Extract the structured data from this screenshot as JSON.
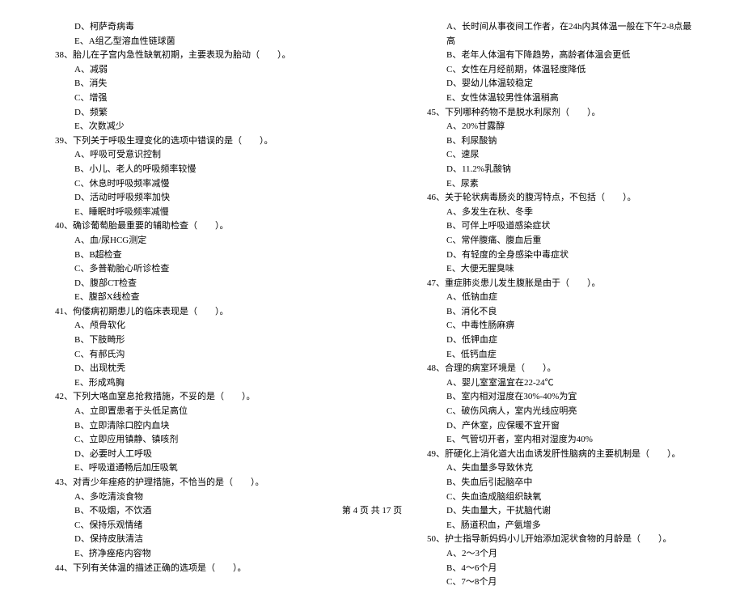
{
  "left": [
    {
      "t": "o",
      "text": "D、柯萨奇病毒"
    },
    {
      "t": "o",
      "text": "E、A组乙型溶血性链球菌"
    },
    {
      "t": "q",
      "text": "38、胎儿在子宫内急性缺氧初期，主要表现为胎动（　　）。"
    },
    {
      "t": "o",
      "text": "A、减弱"
    },
    {
      "t": "o",
      "text": "B、消失"
    },
    {
      "t": "o",
      "text": "C、增强"
    },
    {
      "t": "o",
      "text": "D、频繁"
    },
    {
      "t": "o",
      "text": "E、次数减少"
    },
    {
      "t": "q",
      "text": "39、下列关于呼吸生理变化的选项中错误的是（　　）。"
    },
    {
      "t": "o",
      "text": "A、呼吸可受意识控制"
    },
    {
      "t": "o",
      "text": "B、小儿、老人的呼吸频率较慢"
    },
    {
      "t": "o",
      "text": "C、休息时呼吸频率减慢"
    },
    {
      "t": "o",
      "text": "D、活动时呼吸频率加快"
    },
    {
      "t": "o",
      "text": "E、睡眠时呼吸频率减慢"
    },
    {
      "t": "q",
      "text": "40、确诊葡萄胎最重要的辅助检查（　　）。"
    },
    {
      "t": "o",
      "text": "A、血/尿HCG测定"
    },
    {
      "t": "o",
      "text": "B、B超检查"
    },
    {
      "t": "o",
      "text": "C、多普勒胎心听诊检查"
    },
    {
      "t": "o",
      "text": "D、腹部CT检查"
    },
    {
      "t": "o",
      "text": "E、腹部X线检查"
    },
    {
      "t": "q",
      "text": "41、佝偻病初期患儿的临床表现是（　　）。"
    },
    {
      "t": "o",
      "text": "A、颅骨软化"
    },
    {
      "t": "o",
      "text": "B、下肢畸形"
    },
    {
      "t": "o",
      "text": "C、有郝氏沟"
    },
    {
      "t": "o",
      "text": "D、出现枕秃"
    },
    {
      "t": "o",
      "text": "E、形成鸡胸"
    },
    {
      "t": "q",
      "text": "42、下列大咯血窒息抢救措施，不妥的是（　　）。"
    },
    {
      "t": "o",
      "text": "A、立即置患者于头低足高位"
    },
    {
      "t": "o",
      "text": "B、立即清除口腔内血块"
    },
    {
      "t": "o",
      "text": "C、立即应用镇静、镇咳剂"
    },
    {
      "t": "o",
      "text": "D、必要时人工呼吸"
    },
    {
      "t": "o",
      "text": "E、呼吸道通畅后加压吸氧"
    },
    {
      "t": "q",
      "text": "43、对青少年痤疮的护理措施，不恰当的是（　　）。"
    },
    {
      "t": "o",
      "text": "A、多吃清淡食物"
    },
    {
      "t": "o",
      "text": "B、不吸烟，不饮酒"
    },
    {
      "t": "o",
      "text": "C、保持乐观情绪"
    },
    {
      "t": "o",
      "text": "D、保持皮肤清洁"
    },
    {
      "t": "o",
      "text": "E、挤净痤疮内容物"
    },
    {
      "t": "q",
      "text": "44、下列有关体温的描述正确的选项是（　　）。"
    }
  ],
  "right": [
    {
      "t": "o",
      "text": "A、长时间从事夜间工作者，在24h内其体温一般在下午2-8点最高"
    },
    {
      "t": "o",
      "text": "B、老年人体温有下降趋势，高龄者体温会更低"
    },
    {
      "t": "o",
      "text": "C、女性在月经前期，体温轻度降低"
    },
    {
      "t": "o",
      "text": "D、婴幼儿体温较稳定"
    },
    {
      "t": "o",
      "text": "E、女性体温较男性体温稍高"
    },
    {
      "t": "q",
      "text": "45、下列哪种药物不是脱水利尿剂（　　）。"
    },
    {
      "t": "o",
      "text": "A、20%甘露醇"
    },
    {
      "t": "o",
      "text": "B、利尿酸钠"
    },
    {
      "t": "o",
      "text": "C、速尿"
    },
    {
      "t": "o",
      "text": "D、11.2%乳酸钠"
    },
    {
      "t": "o",
      "text": "E、尿素"
    },
    {
      "t": "q",
      "text": "46、关于轮状病毒肠炎的腹泻特点，不包括（　　）。"
    },
    {
      "t": "o",
      "text": "A、多发生在秋、冬季"
    },
    {
      "t": "o",
      "text": "B、可伴上呼吸道感染症状"
    },
    {
      "t": "o",
      "text": "C、常伴腹痛、腹血后重"
    },
    {
      "t": "o",
      "text": "D、有轻度的全身感染中毒症状"
    },
    {
      "t": "o",
      "text": "E、大便无腥臭味"
    },
    {
      "t": "q",
      "text": "47、重症肺炎患儿发生腹胀是由于（　　）。"
    },
    {
      "t": "o",
      "text": "A、低钠血症"
    },
    {
      "t": "o",
      "text": "B、消化不良"
    },
    {
      "t": "o",
      "text": "C、中毒性肠麻痹"
    },
    {
      "t": "o",
      "text": "D、低钾血症"
    },
    {
      "t": "o",
      "text": "E、低钙血症"
    },
    {
      "t": "q",
      "text": "48、合理的病室环境是（　　）。"
    },
    {
      "t": "o",
      "text": "A、婴儿室室温宜在22-24℃"
    },
    {
      "t": "o",
      "text": "B、室内相对湿度在30%-40%为宜"
    },
    {
      "t": "o",
      "text": "C、破伤风病人，室内光线应明亮"
    },
    {
      "t": "o",
      "text": "D、产休室，应保暖不宜开窗"
    },
    {
      "t": "o",
      "text": "E、气管切开者，室内相对湿度为40%"
    },
    {
      "t": "q",
      "text": "49、肝硬化上消化道大出血诱发肝性脑病的主要机制是（　　）。"
    },
    {
      "t": "o",
      "text": "A、失血量多导致休克"
    },
    {
      "t": "o",
      "text": "B、失血后引起脑卒中"
    },
    {
      "t": "o",
      "text": "C、失血造成脑组织缺氧"
    },
    {
      "t": "o",
      "text": "D、失血量大，干扰脑代谢"
    },
    {
      "t": "o",
      "text": "E、肠道积血，产氨增多"
    },
    {
      "t": "q",
      "text": "50、护士指导新妈妈小儿开始添加泥状食物的月龄是（　　）。"
    },
    {
      "t": "o",
      "text": "A、2～3个月"
    },
    {
      "t": "o",
      "text": "B、4～6个月"
    },
    {
      "t": "o",
      "text": "C、7～8个月"
    }
  ],
  "footer": "第 4 页 共 17 页"
}
